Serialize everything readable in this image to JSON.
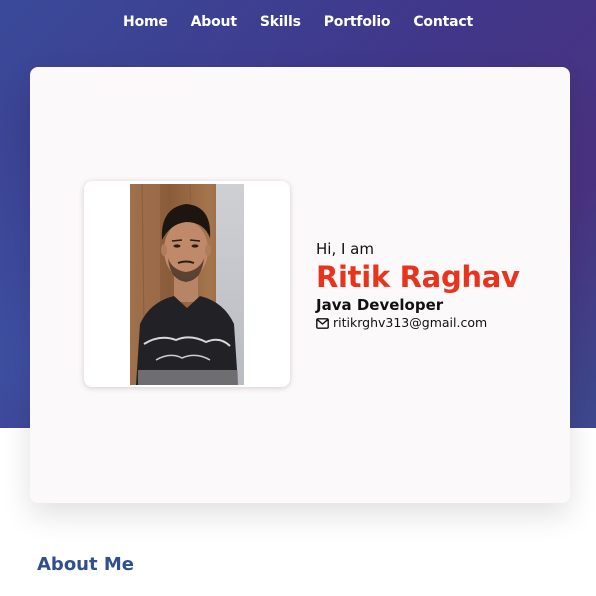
{
  "nav": {
    "items": [
      {
        "label": "Home"
      },
      {
        "label": "About"
      },
      {
        "label": "Skills"
      },
      {
        "label": "Portfolio"
      },
      {
        "label": "Contact"
      }
    ]
  },
  "hero": {
    "greeting": "Hi, I am",
    "name": "Ritik Raghav",
    "role": "Java Developer",
    "email": "ritikrghv313@gmail.com",
    "email_icon": "envelope-icon",
    "photo": "profile-photo",
    "name_color": "#e8341c"
  },
  "about": {
    "title": "About Me"
  },
  "colors": {
    "hero_gradient_start": "#3a4a9a",
    "hero_gradient_end": "#4a3280",
    "card_bg": "#fcf9fa",
    "section_title": "#2f4f8f"
  }
}
